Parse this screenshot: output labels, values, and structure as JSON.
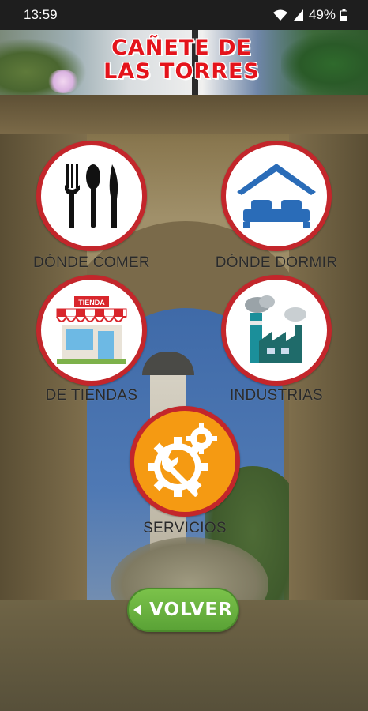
{
  "status_bar": {
    "time": "13:59",
    "battery": "49%"
  },
  "header": {
    "title_line1": "CAÑETE DE",
    "title_line2": "LAS TORRES"
  },
  "menu": [
    {
      "label": "DÓNDE COMER",
      "icon": "cutlery-icon"
    },
    {
      "label": "DÓNDE DORMIR",
      "icon": "bed-icon"
    },
    {
      "label": "DE TIENDAS",
      "icon": "store-icon",
      "sign": "TIENDA"
    },
    {
      "label": "INDUSTRIAS",
      "icon": "factory-icon"
    },
    {
      "label": "SERVICIOS",
      "icon": "gear-wrench-icon"
    }
  ],
  "back_button": {
    "label": "VOLVER"
  },
  "colors": {
    "ring": "#c3262b",
    "title_red": "#e4131b",
    "button_green": "#5aa236",
    "service_orange": "#f59a12"
  }
}
